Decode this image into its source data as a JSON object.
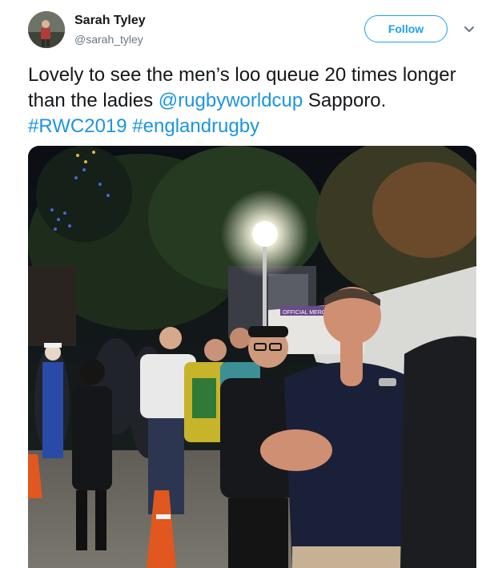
{
  "author": {
    "name": "Sarah Tyley",
    "handle": "@sarah_tyley",
    "avatar_icon": "profile-photo"
  },
  "follow_button": {
    "label": "Follow"
  },
  "menu": {
    "icon": "chevron-down-icon"
  },
  "tweet": {
    "segments": [
      {
        "text": "Lovely to see the men’s loo queue 20 times longer than the ladies ",
        "type": "text"
      },
      {
        "text": "@rugbyworldcup",
        "type": "mention"
      },
      {
        "text": " Sapporo. ",
        "type": "text"
      },
      {
        "text": "#RWC2019",
        "type": "hashtag"
      },
      {
        "text": " ",
        "type": "text"
      },
      {
        "text": "#englandrugby",
        "type": "hashtag"
      }
    ]
  },
  "photo": {
    "description_icon": "photo",
    "sign_text": "OFFICIAL MERCHANDISE"
  },
  "colors": {
    "link": "#1b95e0",
    "follow": "#1da1f2",
    "text": "#14171a",
    "secondary": "#657786"
  }
}
